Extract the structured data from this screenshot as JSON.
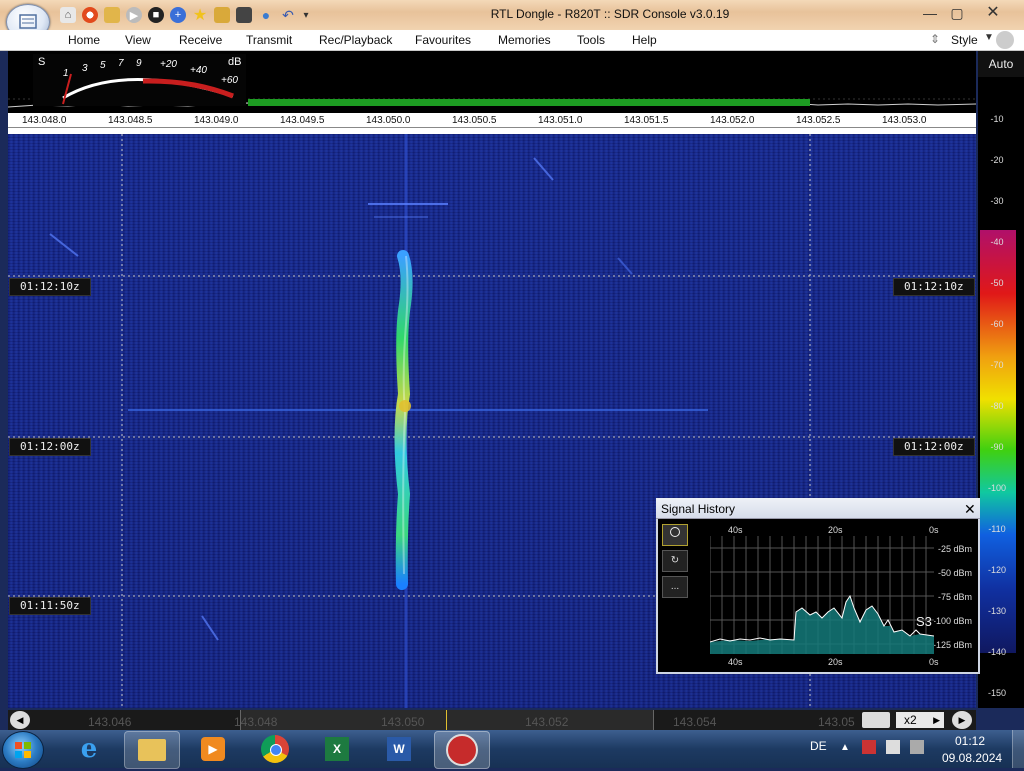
{
  "window": {
    "title": "RTL Dongle - R820T :: SDR Console v3.0.19",
    "controls": [
      "—",
      "▢",
      "✕"
    ]
  },
  "quick_access_icons": [
    "home-icon",
    "lifebuoy-icon",
    "folder-icon",
    "play-icon",
    "stop-icon",
    "plus-icon",
    "star-icon",
    "lock-icon",
    "camera-icon",
    "drop-icon",
    "undo-icon",
    "dropdown-icon"
  ],
  "menu": {
    "items": [
      "Home",
      "View",
      "Receive",
      "Transmit",
      "Rec/Playback",
      "Favourites",
      "Memories",
      "Tools",
      "Help"
    ],
    "style_label": "Style"
  },
  "smeter": {
    "s_label": "S",
    "db_label": "dB",
    "s_ticks": [
      "1",
      "3",
      "5",
      "7",
      "9"
    ],
    "db_ticks": [
      "+20",
      "+40",
      "+60"
    ]
  },
  "spectrum": {
    "auto_label": "Auto",
    "freq_ticks": [
      "143.048.0",
      "143.048.5",
      "143.049.0",
      "143.049.5",
      "143.050.0",
      "143.050.5",
      "143.051.0",
      "143.051.5",
      "143.052.0",
      "143.052.5",
      "143.053.0"
    ]
  },
  "db_scale": [
    "-10",
    "-20",
    "-30",
    "-40",
    "-50",
    "-60",
    "-70",
    "-80",
    "-90",
    "-100",
    "-110",
    "-120",
    "-130",
    "-140",
    "-150"
  ],
  "waterfall": {
    "time_markers": [
      "01:12:10z",
      "01:12:00z",
      "01:11:50z"
    ]
  },
  "bottom_axis": {
    "ticks": [
      "143.046",
      "143.048",
      "143.050",
      "143.052",
      "143.054",
      "143.05"
    ],
    "zoom": "x2"
  },
  "signal_history": {
    "title": "Signal History",
    "top_ticks": [
      "40s",
      "20s",
      "0s"
    ],
    "bottom_ticks": [
      "40s",
      "20s",
      "0s"
    ],
    "y_labels": [
      "-25 dBm",
      "-50 dBm",
      "-75 dBm",
      "-100 dBm",
      "-125 dBm"
    ],
    "s_reading": "S3",
    "buttons": [
      "circle",
      "reset",
      "more"
    ],
    "more_label": "..."
  },
  "taskbar": {
    "apps": [
      "internet-explorer-icon",
      "file-explorer-icon",
      "media-player-icon",
      "chrome-icon",
      "excel-icon",
      "word-icon",
      "sdr-console-icon"
    ],
    "language": "DE",
    "time": "01:12",
    "date": "09.08.2024"
  }
}
